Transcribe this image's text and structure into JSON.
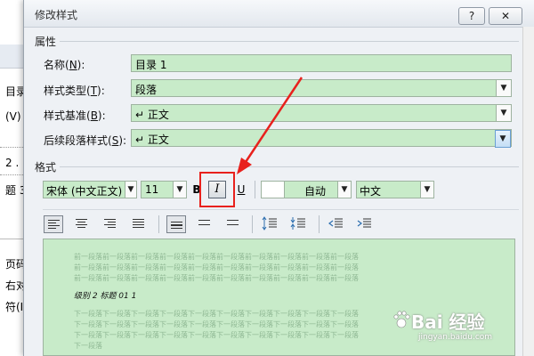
{
  "background_app": {
    "lines": [
      "目录",
      "(V)",
      "2 .",
      "题 3",
      "页码(S",
      "右对齐",
      "符(I"
    ]
  },
  "dialog": {
    "title": "修改样式",
    "help_button": "?",
    "close_button": "✕"
  },
  "properties": {
    "section_label": "属性",
    "name_label": "名称(",
    "name_key": "N",
    "name_value": "目录 1",
    "type_label": "样式类型(",
    "type_key": "T",
    "type_value": "段落",
    "based_label": "样式基准(",
    "based_key": "B",
    "based_value": "↵ 正文",
    "next_label": "后续段落样式(",
    "next_key": "S",
    "next_value": "↵ 正文",
    "label_suffix": "):"
  },
  "format": {
    "section_label": "格式",
    "font": "宋体 (中文正文)",
    "size": "11",
    "bold": "B",
    "italic": "I",
    "underline": "U",
    "color": "自动",
    "script": "中文"
  },
  "preview": {
    "prev_text": "前一段落前一段落前一段落前一段落前一段落前一段落前一段落前一段落前一段落前一段落",
    "prev_text_short": "前一段落前一段落前一段落前一段落前一段落前一段落前一段落前一段落前一段落前一段落",
    "sample": "级别 2 标题 01      1",
    "next_text": "下一段落下一段落下一段落下一段落下一段落下一段落下一段落下一段落下一段落下一段落",
    "next_tail": "下一段落"
  },
  "watermark": {
    "text": "Bai 经验",
    "sub": "jingyan.baidu.com"
  },
  "colors": {
    "field_bg": "#c8ebc9",
    "highlight": "#e8211d"
  }
}
